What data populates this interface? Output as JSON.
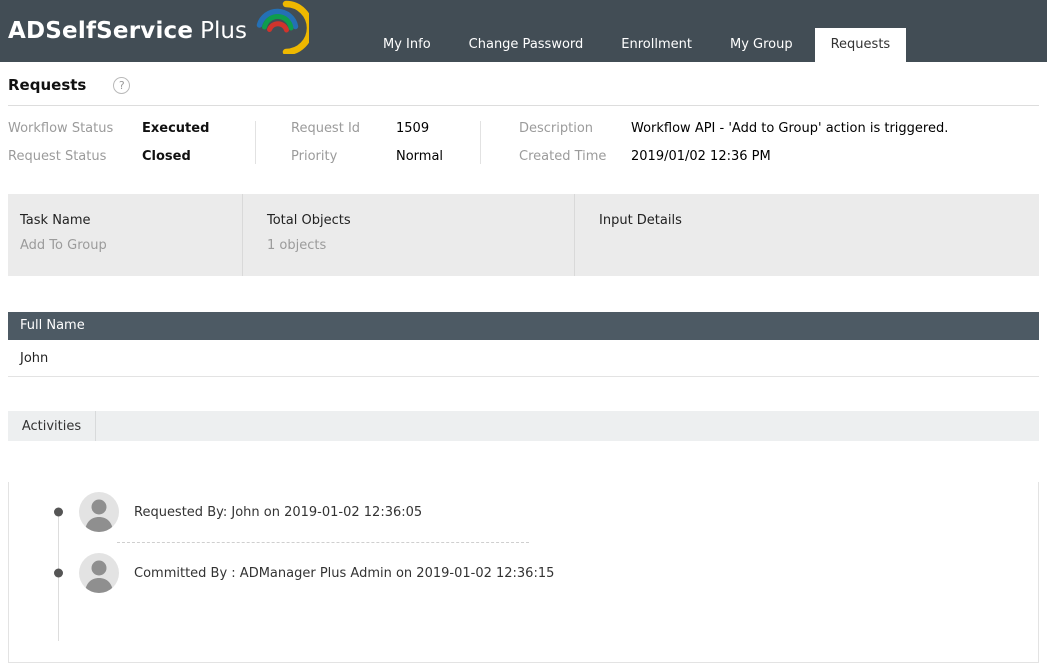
{
  "header": {
    "brand_bold": "ADSelfService",
    "brand_light": "Plus",
    "tabs": [
      {
        "label": "My Info",
        "active": false
      },
      {
        "label": "Change Password",
        "active": false
      },
      {
        "label": "Enrollment",
        "active": false
      },
      {
        "label": "My Group",
        "active": false
      },
      {
        "label": "Requests",
        "active": true
      }
    ]
  },
  "page": {
    "title": "Requests",
    "help_icon": "?"
  },
  "request_summary": {
    "fields": [
      {
        "label": "Workflow Status",
        "value": "Executed"
      },
      {
        "label": "Request Status",
        "value": "Closed"
      },
      {
        "label": "Request Id",
        "value": "1509"
      },
      {
        "label": "Priority",
        "value": "Normal"
      },
      {
        "label": "Description",
        "value": "Workflow API - 'Add to Group' action is triggered."
      },
      {
        "label": "Created Time",
        "value": "2019/01/02 12:36 PM"
      }
    ]
  },
  "task_panel": {
    "columns": [
      {
        "label": "Task Name",
        "value": "Add To Group"
      },
      {
        "label": "Total Objects",
        "value": "1 objects"
      },
      {
        "label": "Input Details",
        "value": ""
      }
    ]
  },
  "objects_table": {
    "column_header": "Full Name",
    "rows": [
      {
        "full_name": "John"
      }
    ]
  },
  "activities": {
    "tab_label": "Activities",
    "items": [
      {
        "text": "Requested By: John on 2019-01-02 12:36:05"
      },
      {
        "text": "Committed By : ADManager Plus Admin on 2019-01-02 12:36:15"
      }
    ]
  },
  "colors": {
    "header_bg": "#424d55",
    "table_header_bg": "#4d5a64",
    "panel_bg": "#ebebeb",
    "logo_arc_red": "#d0342c",
    "logo_arc_green": "#0f9d4d",
    "logo_arc_blue": "#2470b5",
    "logo_arc_yellow": "#eeb800"
  }
}
